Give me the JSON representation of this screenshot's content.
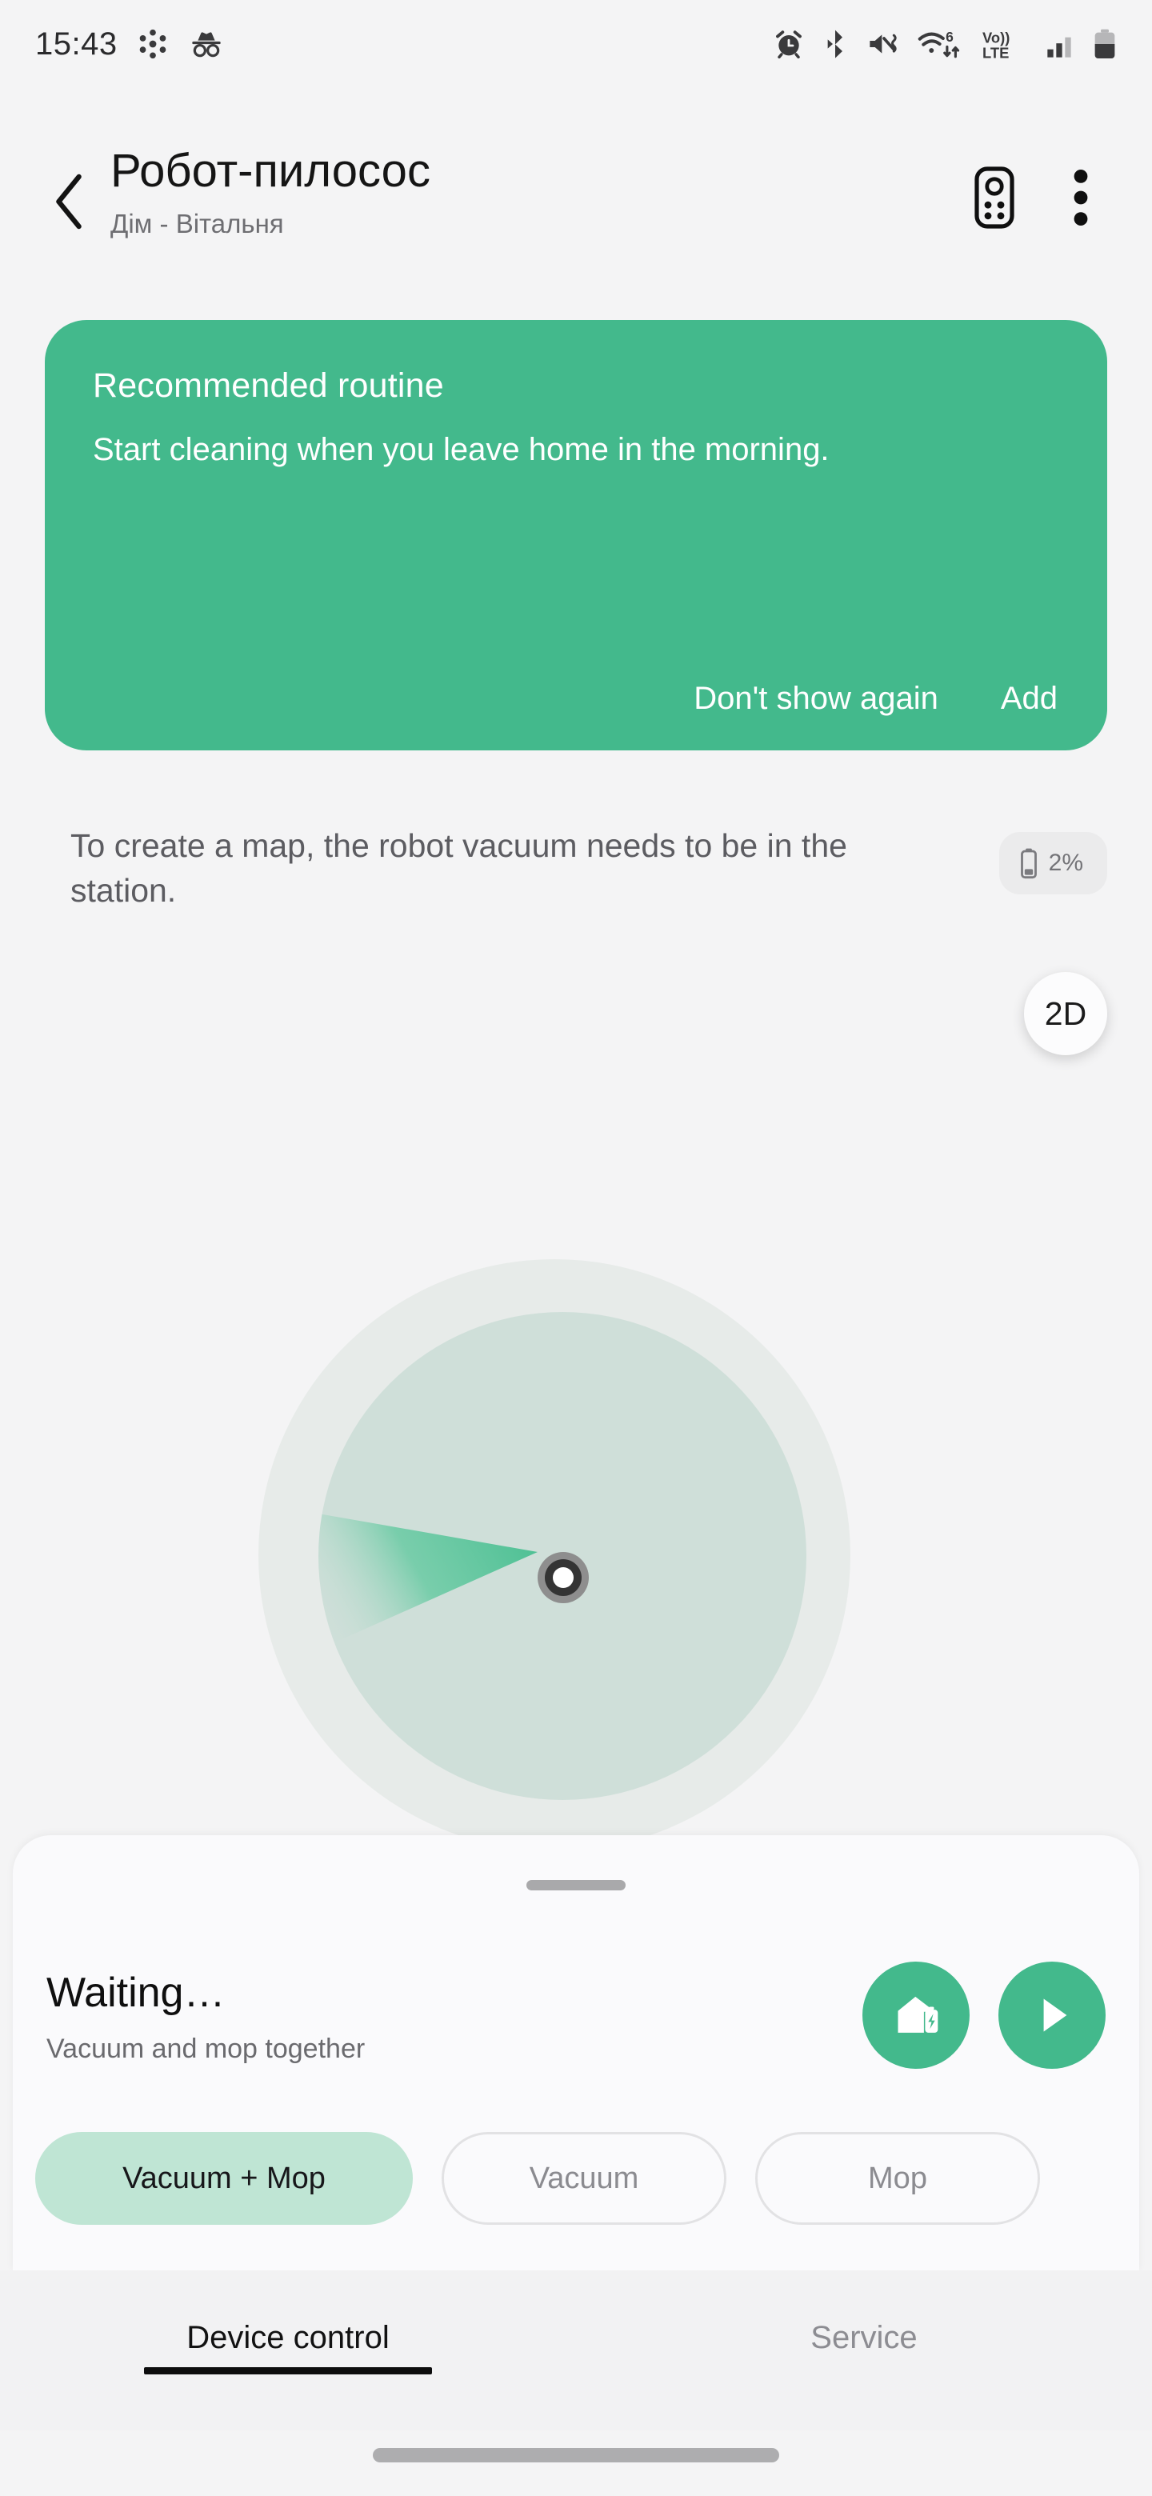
{
  "status_bar": {
    "time": "15:43",
    "left_icons": [
      "smartthings-icon",
      "incognito-icon"
    ],
    "right_icons": [
      "alarm-icon",
      "bluetooth-icon",
      "mute-vibrate-icon",
      "wifi6-data-icon",
      "volte-icon",
      "signal-bars-icon",
      "battery-icon"
    ],
    "wifi_generation": "6",
    "network_label": "Vo))",
    "network_label2": "LTE"
  },
  "header": {
    "back_icon": "chevron-left-icon",
    "title": "Робот-пилосос",
    "subtitle": "Дім - Вітальня",
    "remote_icon": "remote-control-icon",
    "more_icon": "more-vertical-icon"
  },
  "routine_card": {
    "title": "Recommended routine",
    "description": "Start cleaning when you leave home in the morning.",
    "dismiss_label": "Don't show again",
    "add_label": "Add",
    "background_color": "#43b98c"
  },
  "map": {
    "info_text": "To create a map, the robot vacuum needs to be in the station.",
    "battery_percent": "2%",
    "battery_icon": "battery-vertical-icon",
    "view_mode_label": "2D",
    "radar_outer_color": "#E7EBE9",
    "radar_inner_color": "#CFDFD9",
    "sweep_color": "#44BC8F",
    "robot_marker": "robot-position-marker"
  },
  "sheet": {
    "handle": "drag-handle",
    "status_title": "Waiting…",
    "status_subtitle": "Vacuum and mop together",
    "dock_button_icon": "home-charge-icon",
    "play_button_icon": "play-icon",
    "accent_color": "#43b98c",
    "chips": [
      {
        "label": "Vacuum + Mop",
        "selected": true
      },
      {
        "label": "Vacuum",
        "selected": false
      },
      {
        "label": "Mop",
        "selected": false
      }
    ],
    "selected_chip_color": "#BFE5D4"
  },
  "tabs": [
    {
      "label": "Device control",
      "active": true
    },
    {
      "label": "Service",
      "active": false
    }
  ],
  "nav": {
    "gesture_pill": "home-gesture-pill"
  }
}
